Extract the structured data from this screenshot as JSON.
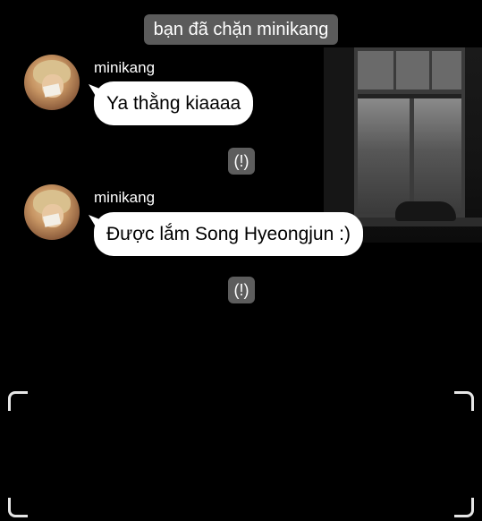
{
  "system_message": "bạn đã chặn minikang",
  "messages": [
    {
      "sender": "minikang",
      "text": "Ya thằng kiaaaa",
      "warning": "(!)"
    },
    {
      "sender": "minikang",
      "text": "Được lắm Song Hyeongjun :)",
      "warning": "(!)"
    }
  ],
  "colors": {
    "background": "#000000",
    "bubble": "#ffffff",
    "system_pill": "#5b5b5b",
    "warning_badge": "#5d5d5d"
  },
  "icons": [
    "avatar-photo",
    "warning-badge",
    "viewfinder-corner"
  ]
}
